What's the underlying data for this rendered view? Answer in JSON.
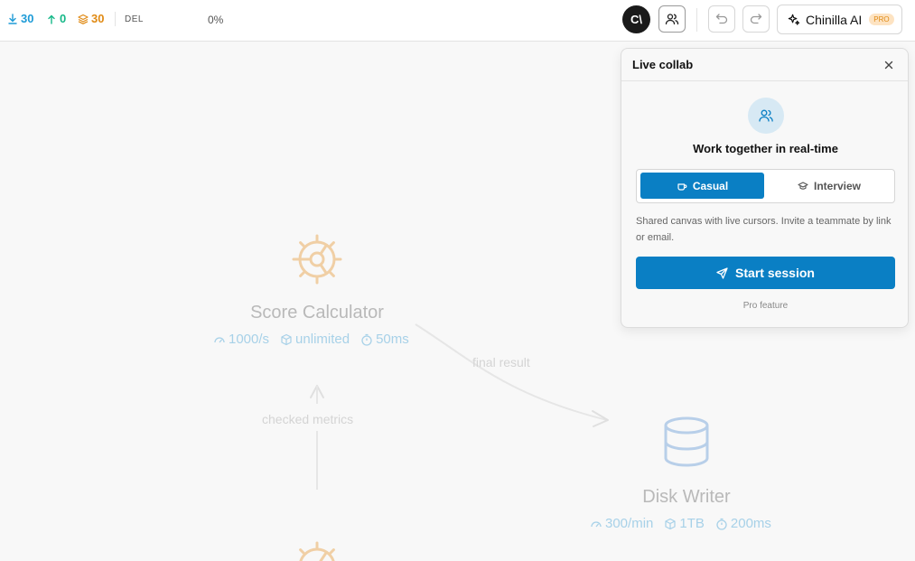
{
  "topbar": {
    "downloads": "30",
    "uploads": "0",
    "layers": "30",
    "del_label": "DEL",
    "percent": "0%",
    "logo_text": "C\\",
    "ai_label": "Chinilla AI",
    "pro_badge": "PRO"
  },
  "canvas": {
    "nodes": [
      {
        "title": "Score Calculator",
        "icon": "gear-icon",
        "rate": "1000/s",
        "capacity": "unlimited",
        "latency": "50ms"
      },
      {
        "title": "Disk Writer",
        "icon": "database-icon",
        "rate": "300/min",
        "capacity": "1TB",
        "latency": "200ms"
      }
    ],
    "edges": [
      {
        "label": "final result"
      },
      {
        "label": "checked metrics"
      }
    ]
  },
  "panel": {
    "title": "Live collab",
    "heading": "Work together in real-time",
    "mode_casual": "Casual",
    "mode_interview": "Interview",
    "description": "Shared canvas with live cursors. Invite a teammate by link or email.",
    "start_label": "Start session",
    "pro_note": "Pro feature"
  },
  "colors": {
    "accent": "#0a7fc4",
    "downloads": "#1e9bd7",
    "uploads": "#16b888",
    "layers": "#e08a14",
    "gear": "#f0cfa5",
    "database": "#b8cfe9"
  }
}
